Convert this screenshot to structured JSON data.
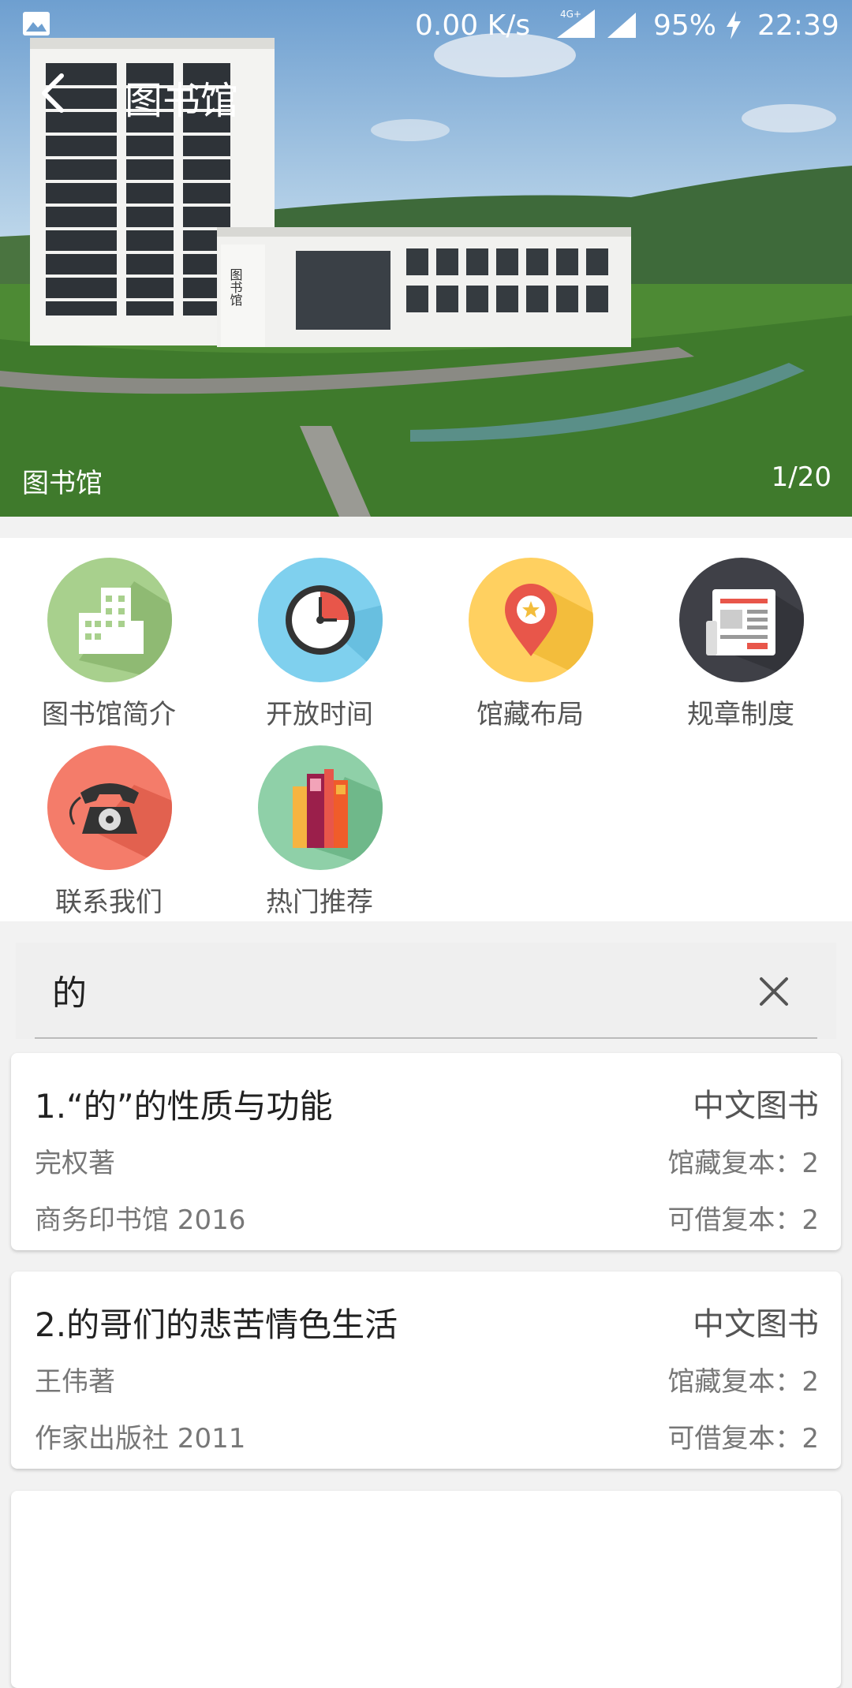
{
  "status_bar": {
    "net_speed": "0.00 K/s",
    "network_type": "4G+",
    "battery": "95%",
    "time": "22:39",
    "icons": [
      "gallery-icon",
      "signal-icon",
      "charging-icon"
    ]
  },
  "header": {
    "title": "图书馆",
    "back_icon": "back-arrow-icon"
  },
  "banner": {
    "caption": "图书馆",
    "counter": "1/20",
    "building_sign": "图书馆"
  },
  "features": [
    {
      "label": "图书馆简介",
      "icon": "building-icon",
      "color": "#a8d08d"
    },
    {
      "label": "开放时间",
      "icon": "clock-icon",
      "color": "#7fd0ee"
    },
    {
      "label": "馆藏布局",
      "icon": "location-pin-icon",
      "color": "#ffd060"
    },
    {
      "label": "规章制度",
      "icon": "newspaper-icon",
      "color": "#3f4047"
    },
    {
      "label": "联系我们",
      "icon": "telephone-icon",
      "color": "#f47c6a"
    },
    {
      "label": "热门推荐",
      "icon": "books-icon",
      "color": "#8fd0a8"
    }
  ],
  "search": {
    "value": "的",
    "clear_icon": "close-icon"
  },
  "results": [
    {
      "title": "1.“的”的性质与功能",
      "type": "中文图书",
      "author": "完权著",
      "holdings": "馆藏复本：2",
      "publisher": "商务印书馆 2016",
      "available": "可借复本：2"
    },
    {
      "title": "2.的哥们的悲苦情色生活",
      "type": "中文图书",
      "author": "王伟著",
      "holdings": "馆藏复本：2",
      "publisher": "作家出版社 2011",
      "available": "可借复本：2"
    }
  ]
}
